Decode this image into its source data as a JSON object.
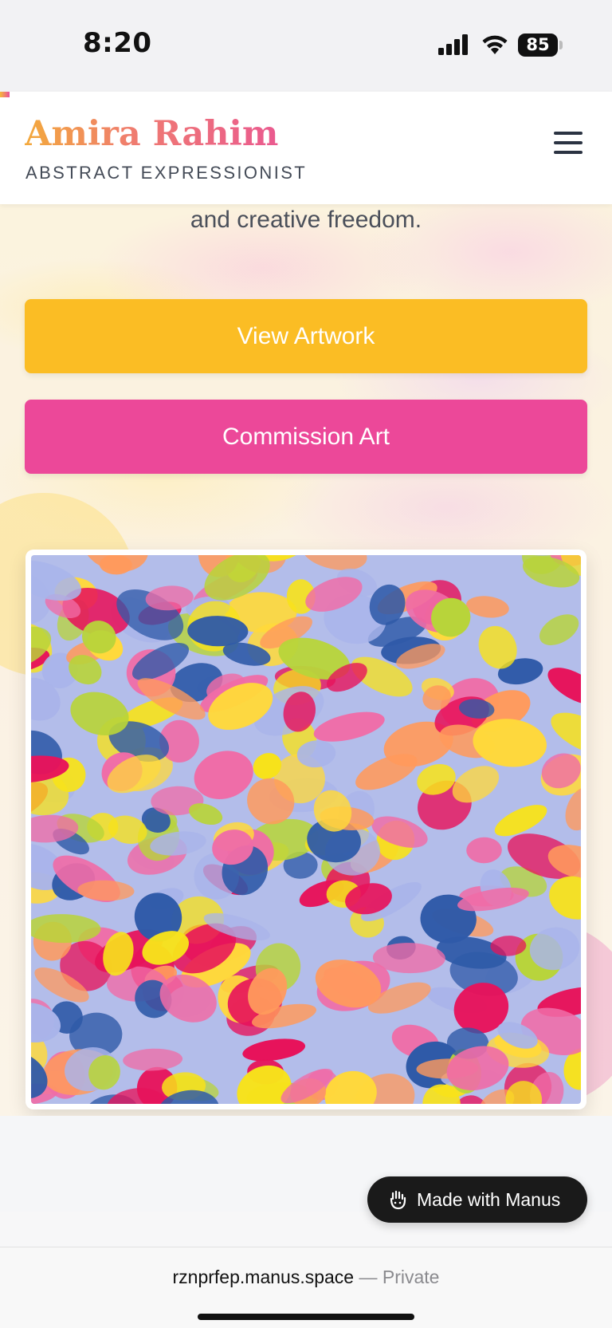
{
  "status_bar": {
    "time": "8:20",
    "battery_level": "85",
    "icons": [
      "signal-icon",
      "wifi-icon",
      "battery-icon"
    ]
  },
  "header": {
    "artist_name": "Amira Rahim",
    "tagline": "ABSTRACT EXPRESSIONIST",
    "menu_icon": "hamburger-menu-icon",
    "name_gradient": [
      "#f3a93c",
      "#ea5a8f"
    ]
  },
  "hero": {
    "intro_fragment": "and creative freedom.",
    "buttons": {
      "view_artwork": "View Artwork",
      "commission_art": "Commission Art"
    },
    "colors": {
      "view_button": "#fbbd24",
      "commission_button": "#ec4899"
    },
    "artwork": {
      "description": "featured-abstract-painting",
      "palette": [
        "#f7e21b",
        "#f06ca7",
        "#a9b4ea",
        "#e7135b",
        "#2f5aa8",
        "#b8d43a",
        "#ff9a5c",
        "#ffd93b"
      ]
    }
  },
  "badge": {
    "label": "Made with Manus",
    "icon": "manus-hand-icon"
  },
  "browser": {
    "domain": "rznprfep.manus.space",
    "privacy": "— Private"
  }
}
